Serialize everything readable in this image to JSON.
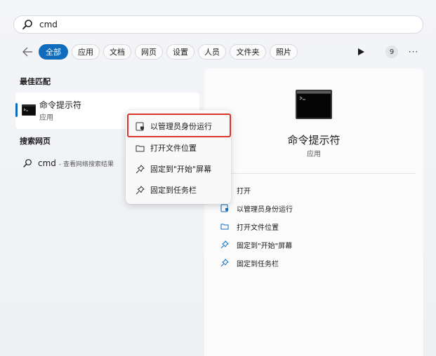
{
  "search": {
    "query": "cmd"
  },
  "filters": {
    "chips": [
      {
        "label": "全部",
        "active": true
      },
      {
        "label": "应用",
        "active": false
      },
      {
        "label": "文档",
        "active": false
      },
      {
        "label": "网页",
        "active": false
      },
      {
        "label": "设置",
        "active": false
      },
      {
        "label": "人员",
        "active": false
      },
      {
        "label": "文件夹",
        "active": false
      },
      {
        "label": "照片",
        "active": false
      }
    ],
    "badge_count": "9",
    "more_label": "···"
  },
  "left": {
    "best_match_title": "最佳匹配",
    "best_match": {
      "name": "命令提示符",
      "type": "应用"
    },
    "web_title": "搜索网页",
    "web_query": "cmd",
    "web_hint": "- 查看网络搜索结果"
  },
  "context_menu": {
    "items": [
      "以管理员身份运行",
      "打开文件位置",
      "固定到\"开始\"屏幕",
      "固定到任务栏"
    ]
  },
  "panel": {
    "title": "命令提示符",
    "subtitle": "应用",
    "actions": [
      "打开",
      "以管理员身份运行",
      "打开文件位置",
      "固定到\"开始\"屏幕",
      "固定到任务栏"
    ]
  },
  "colors": {
    "accent": "#0f6cbd",
    "highlight_border": "#d9342b",
    "panel_bg": "#fbfbfc"
  }
}
